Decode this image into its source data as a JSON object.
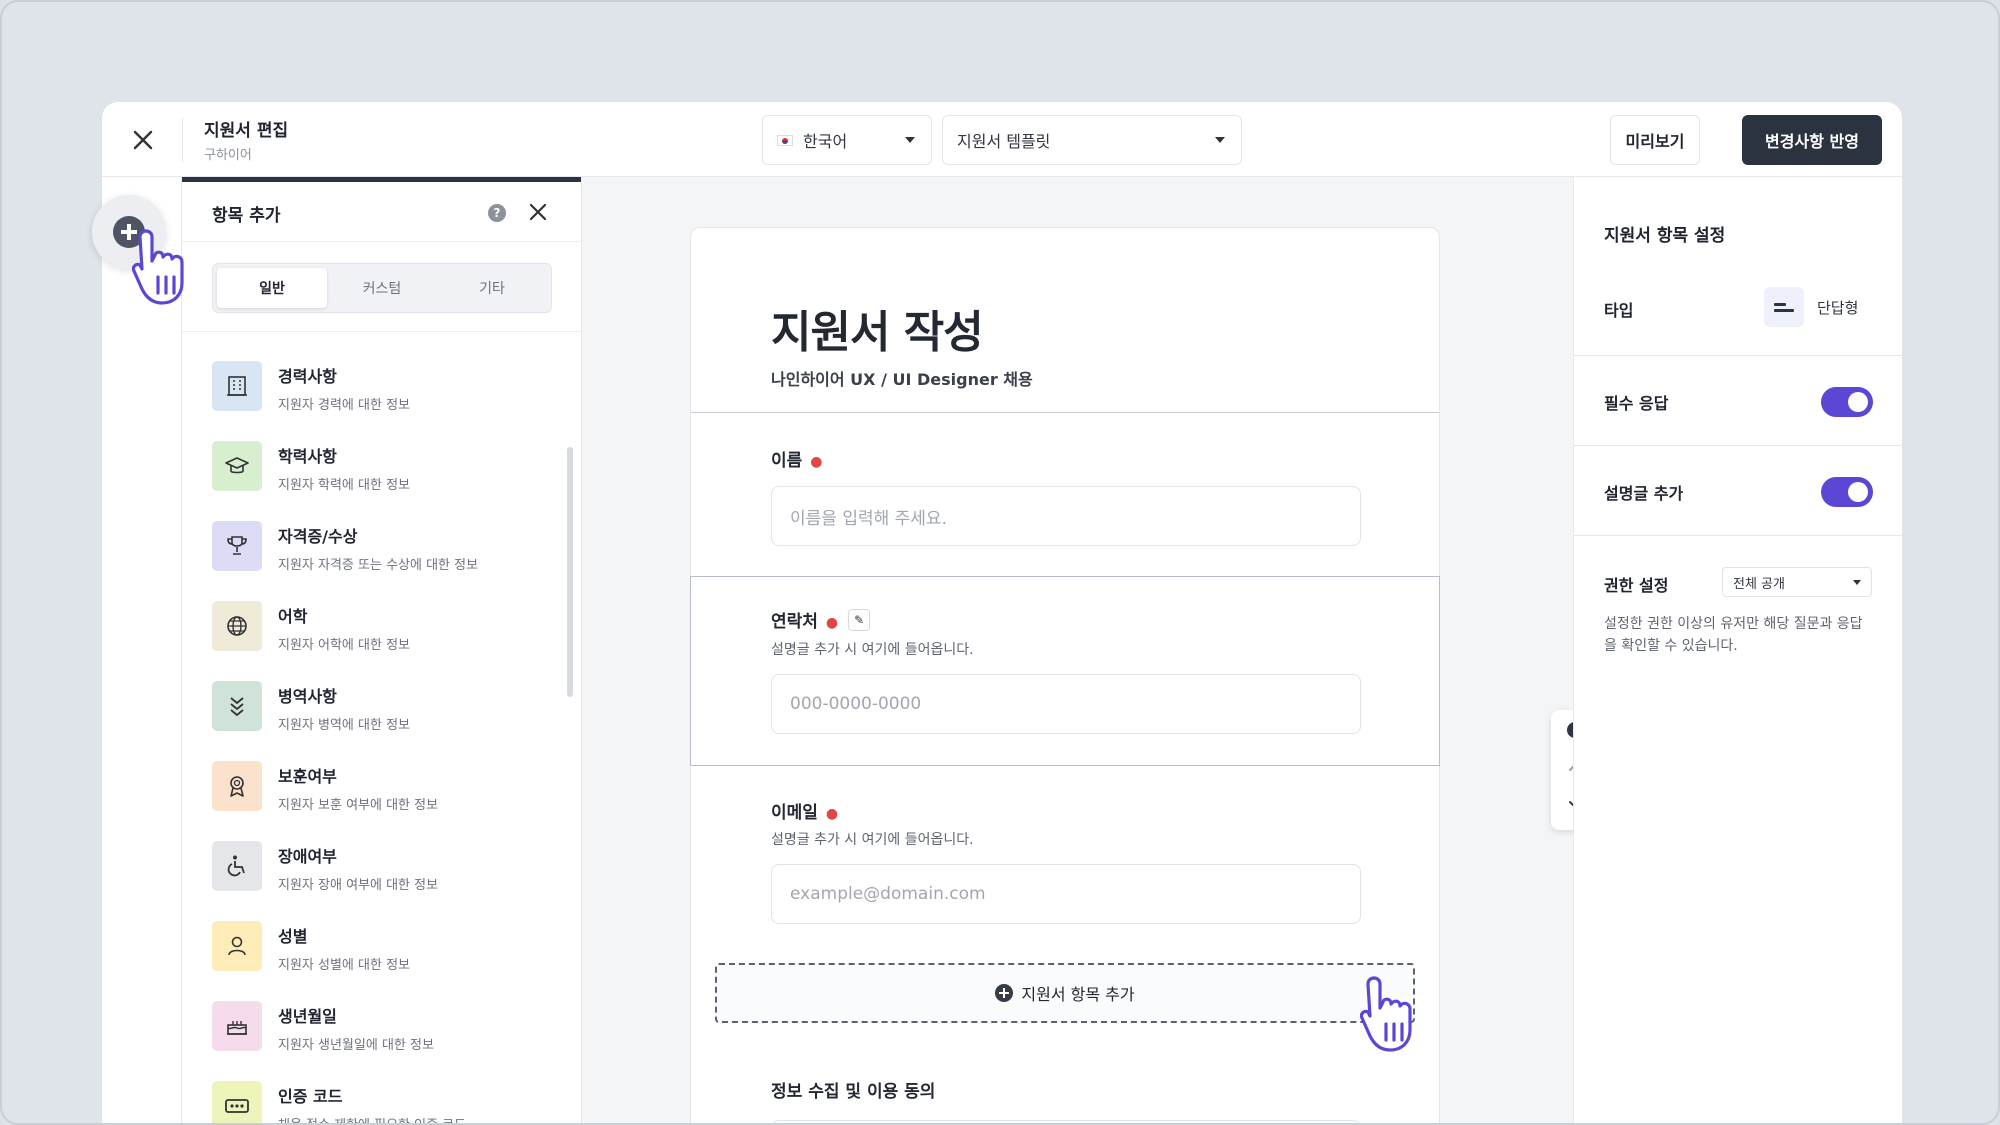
{
  "header": {
    "title": "지원서 편집",
    "subtitle": "구하이어",
    "language": "한국어",
    "template": "지원서 템플릿",
    "preview_label": "미리보기",
    "apply_label": "변경사항 반영"
  },
  "panel": {
    "title": "항목 추가",
    "tabs": [
      {
        "label": "일반",
        "active": true
      },
      {
        "label": "커스텀",
        "active": false
      },
      {
        "label": "기타",
        "active": false
      }
    ],
    "items": [
      {
        "label": "경력사항",
        "desc": "지원자 경력에 대한 정보",
        "icon": "building-icon",
        "color": "#d8e6f3"
      },
      {
        "label": "학력사항",
        "desc": "지원자 학력에 대한 정보",
        "icon": "graduation-cap-icon",
        "color": "#d8efcf"
      },
      {
        "label": "자격증/수상",
        "desc": "지원자 자격증 또는 수상에 대한 정보",
        "icon": "trophy-icon",
        "color": "#dddcf7"
      },
      {
        "label": "어학",
        "desc": "지원자 어학에 대한 정보",
        "icon": "globe-icon",
        "color": "#efebd8"
      },
      {
        "label": "병역사항",
        "desc": "지원자 병역에 대한 정보",
        "icon": "chevrons-down-icon",
        "color": "#cfe3d8"
      },
      {
        "label": "보훈여부",
        "desc": "지원자 보훈 여부에 대한 정보",
        "icon": "award-icon",
        "color": "#fbe2cc"
      },
      {
        "label": "장애여부",
        "desc": "지원자 장애 여부에 대한 정보",
        "icon": "wheelchair-icon",
        "color": "#e5e6ea"
      },
      {
        "label": "성별",
        "desc": "지원자 성별에 대한 정보",
        "icon": "person-icon",
        "color": "#fdebb8"
      },
      {
        "label": "생년월일",
        "desc": "지원자 생년월일에 대한 정보",
        "icon": "cake-icon",
        "color": "#f6dbec"
      },
      {
        "label": "인증 코드",
        "desc": "채용 접수 제한에 필요한 인증 코드",
        "icon": "code-icon",
        "color": "#eef3b9"
      }
    ]
  },
  "form": {
    "title": "지원서 작성",
    "subtitle": "나인하이어 UX / UI Designer 채용",
    "fields": [
      {
        "label": "이름",
        "placeholder": "이름을 입력해 주세요.",
        "desc": ""
      },
      {
        "label": "연락처",
        "placeholder": "000-0000-0000",
        "desc": "설명글 추가 시 여기에 들어옵니다."
      },
      {
        "label": "이메일",
        "placeholder": "example@domain.com",
        "desc": "설명글 추가 시 여기에 들어옵니다."
      }
    ],
    "add_field_label": "지원서 항목 추가",
    "consent_label": "정보 수집 및 이용 동의"
  },
  "settings": {
    "title": "지원서 항목 설정",
    "type_label": "타입",
    "type_value": "단답형",
    "required_label": "필수 응답",
    "required_on": true,
    "desc_label": "설명글 추가",
    "desc_on": true,
    "permission_label": "권한 설정",
    "permission_value": "전체 공개",
    "permission_help": "설정한 권한 이상의 유저만 해당 질문과 응답을 확인할 수 있습니다."
  },
  "colors": {
    "accent": "#5b47d6",
    "dark": "#2b3240",
    "required": "#e14545"
  }
}
